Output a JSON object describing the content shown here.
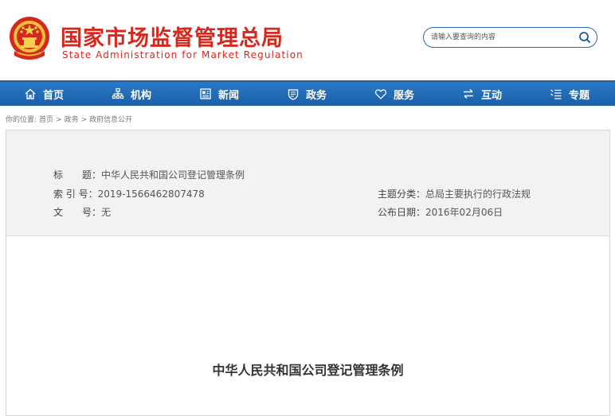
{
  "header": {
    "title_cn": "国家市场监督管理总局",
    "title_en": "State Administration for Market Regulation",
    "emblem_icon": "national-emblem-icon"
  },
  "search": {
    "placeholder": "请输入要查询的内容",
    "icon": "search-icon"
  },
  "colors": {
    "brand_red": "#d6281f",
    "nav_blue": "#1f67b0"
  },
  "nav": {
    "items": [
      {
        "label": "首页",
        "icon": "home-icon"
      },
      {
        "label": "机构",
        "icon": "org-chart-icon"
      },
      {
        "label": "新闻",
        "icon": "newspaper-icon"
      },
      {
        "label": "政务",
        "icon": "government-affairs-icon"
      },
      {
        "label": "服务",
        "icon": "heart-icon"
      },
      {
        "label": "互动",
        "icon": "exchange-arrows-icon"
      },
      {
        "label": "专题",
        "icon": "topic-list-icon"
      }
    ]
  },
  "breadcrumb": {
    "prefix": "你的位置:",
    "items": [
      "首页",
      "政务",
      "政府信息公开"
    ],
    "separator": ">"
  },
  "meta": {
    "title_label": "标　　题：",
    "title_value": "中华人民共和国公司登记管理条例",
    "index_label": "索 引 号：",
    "index_value": "2019-1566462807478",
    "docno_label": "文　　号：",
    "docno_value": "无",
    "category_label": "主题分类：",
    "category_value": "总局主要执行的行政法规",
    "date_label": "公布日期：",
    "date_value": "2016年02月06日"
  },
  "document": {
    "heading": "中华人民共和国公司登记管理条例"
  }
}
